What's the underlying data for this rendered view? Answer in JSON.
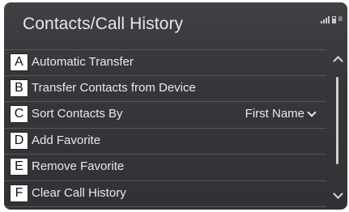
{
  "header": {
    "title": "Contacts/Call History",
    "status_icons": [
      "signal-strength-icon",
      "battery-icon",
      "bluetooth-icon"
    ],
    "bluetooth_glyph": "ʙ"
  },
  "menu": {
    "items": [
      {
        "callout": "A",
        "label": "Automatic Transfer",
        "value": ""
      },
      {
        "callout": "B",
        "label": "Transfer Contacts from Device",
        "value": ""
      },
      {
        "callout": "C",
        "label": "Sort Contacts By",
        "value": "First Name"
      },
      {
        "callout": "D",
        "label": "Add Favorite",
        "value": ""
      },
      {
        "callout": "E",
        "label": "Remove Favorite",
        "value": ""
      },
      {
        "callout": "F",
        "label": "Clear Call History",
        "value": ""
      }
    ]
  },
  "scrollbar": {
    "icons": [
      "chevron-up-icon",
      "chevron-down-icon"
    ]
  },
  "colors": {
    "screen_background": "#35373a",
    "text": "#e9e9e9",
    "divider": "#55585c",
    "callout_box": "#ffffff"
  }
}
